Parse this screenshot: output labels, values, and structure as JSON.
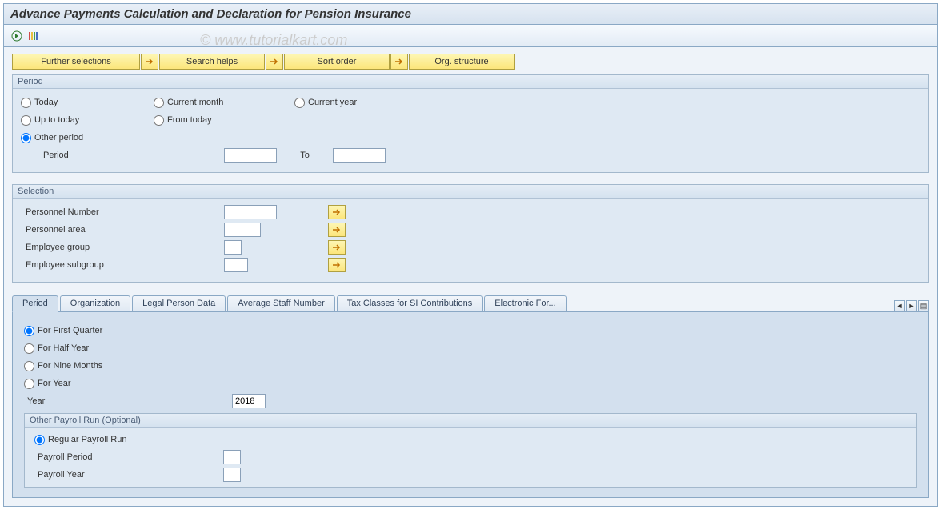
{
  "title": "Advance Payments Calculation and Declaration for Pension Insurance",
  "watermark": "© www.tutorialkart.com",
  "toolbar_buttons": {
    "further_selections": "Further selections",
    "search_helps": "Search helps",
    "sort_order": "Sort order",
    "org_structure": "Org. structure"
  },
  "period_group": {
    "title": "Period",
    "radios": {
      "today": "Today",
      "up_to_today": "Up to today",
      "other_period": "Other period",
      "current_month": "Current month",
      "from_today": "From today",
      "current_year": "Current year"
    },
    "period_label": "Period",
    "to_label": "To",
    "period_from": "",
    "period_to": ""
  },
  "selection_group": {
    "title": "Selection",
    "rows": [
      {
        "label": "Personnel Number",
        "value": ""
      },
      {
        "label": "Personnel area",
        "value": ""
      },
      {
        "label": "Employee group",
        "value": ""
      },
      {
        "label": "Employee subgroup",
        "value": ""
      }
    ]
  },
  "tabstrip": {
    "tabs": [
      "Period",
      "Organization",
      "Legal Person Data",
      "Average Staff Number",
      "Tax Classes for SI Contributions",
      "Electronic For..."
    ],
    "active": 0
  },
  "tab_period": {
    "radios": {
      "first_quarter": "For First Quarter",
      "half_year": "For Half Year",
      "nine_months": "For Nine Months",
      "for_year": "For Year"
    },
    "year_label": "Year",
    "year_value": "2018",
    "subgroup": {
      "title": "Other Payroll Run (Optional)",
      "regular": "Regular Payroll Run",
      "payroll_period_label": "Payroll Period",
      "payroll_period_value": "",
      "payroll_year_label": "Payroll Year",
      "payroll_year_value": ""
    }
  }
}
